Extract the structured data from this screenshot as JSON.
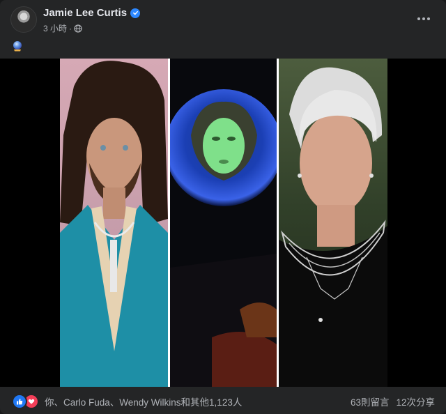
{
  "post": {
    "author": "Jamie Lee Curtis",
    "verified_badge_icon": "check-badge-icon",
    "time": "3 小時",
    "separator": "·",
    "audience_icon": "globe-icon",
    "caption_emoji": "crystal-ball-emoji-icon"
  },
  "media": {
    "panels": [
      {
        "name": "photo-left-portrait"
      },
      {
        "name": "photo-center-crystal-ball"
      },
      {
        "name": "photo-right-portrait"
      }
    ]
  },
  "footer": {
    "reaction_icons": [
      "like-icon",
      "love-icon"
    ],
    "reactions_text": "你、Carlo Fuda、Wendy Wilkins和其他1,123人",
    "comments": "63則留言",
    "shares": "12次分享"
  },
  "colors": {
    "background": "#242526",
    "text_primary": "#e4e6eb",
    "text_secondary": "#b0b3b8",
    "verified_blue": "#2d88ff",
    "like_blue": "#2078f4",
    "love_red": "#f33e58"
  }
}
